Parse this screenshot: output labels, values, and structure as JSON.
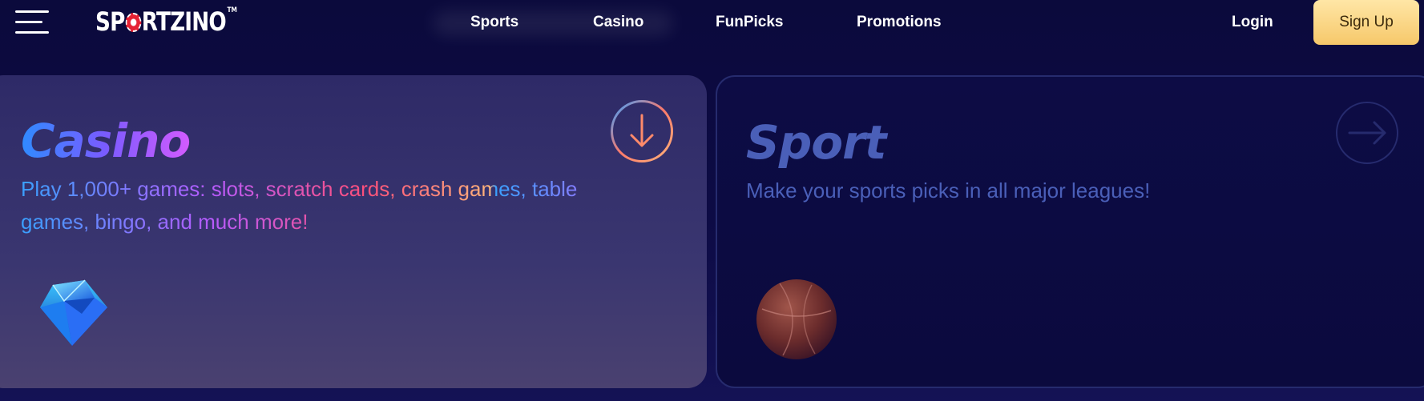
{
  "header": {
    "logo": {
      "text_before": "SP",
      "text_after": "RTZINO",
      "trademark": "TM"
    },
    "nav": [
      {
        "label": "Sports"
      },
      {
        "label": "Casino"
      },
      {
        "label": "FunPicks"
      },
      {
        "label": "Promotions"
      }
    ],
    "login_label": "Login",
    "signup_label": "Sign Up"
  },
  "cards": {
    "casino": {
      "title": "Casino",
      "description": "Play 1,000+ games: slots, scratch cards, crash games, table games, bingo, and much more!",
      "action_icon": "arrow-down-circle-icon",
      "art_icon": "diamond-icon"
    },
    "sport": {
      "title": "Sport",
      "description": "Make your sports picks in all major leagues!",
      "action_icon": "arrow-right-circle-icon",
      "art_icon": "basketball-icon"
    }
  },
  "colors": {
    "background": "#0b0a3c",
    "signup_bg": "#f6c86a",
    "sport_text": "#4a5fb8",
    "logo_chip": "#e52233"
  }
}
